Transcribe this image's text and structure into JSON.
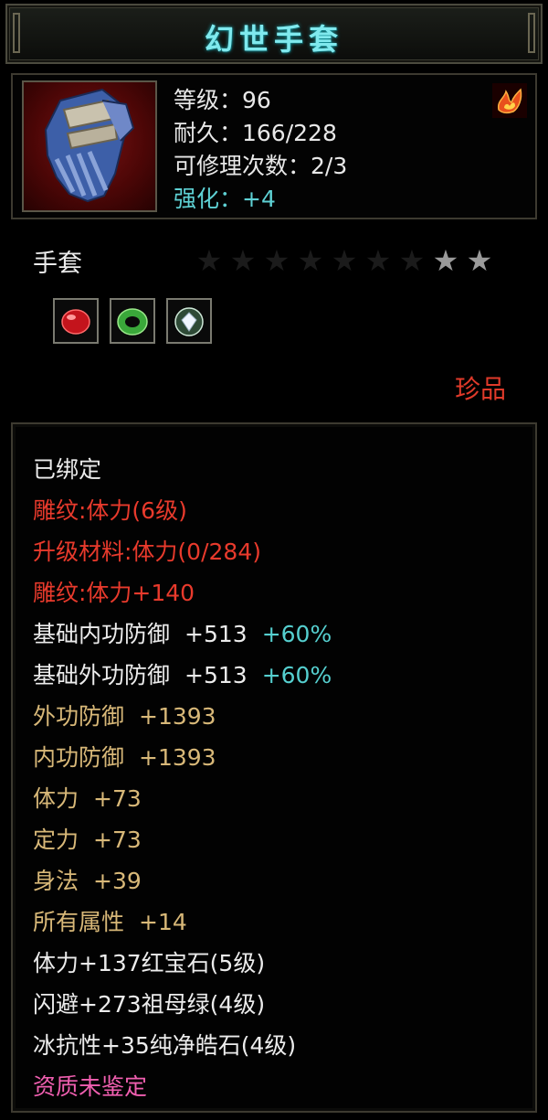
{
  "title": "幻世手套",
  "stats": {
    "level": "等级：96",
    "durability": "耐久：166/228",
    "repairs": "可修理次数：2/3",
    "enhance": "强化：+4"
  },
  "item_type": "手套",
  "stars": {
    "total": 9,
    "filled": 2
  },
  "gems": [
    "red-gem-icon",
    "green-jade-ring-icon",
    "white-diamond-icon"
  ],
  "rarity": "珍品",
  "properties": {
    "bound": "已绑定",
    "engrave_level": "雕纹:体力(6级)",
    "upgrade_material": "升级材料:体力(0/284)",
    "engrave_bonus": "雕纹:体力+140",
    "base_inner_def": {
      "label": "基础内功防御",
      "value": "+513",
      "bonus": "+60%"
    },
    "base_outer_def": {
      "label": "基础外功防御",
      "value": "+513",
      "bonus": "+60%"
    },
    "outer_def": {
      "label": "外功防御",
      "value": "+1393"
    },
    "inner_def": {
      "label": "内功防御",
      "value": "+1393"
    },
    "stamina": {
      "label": "体力",
      "value": "+73"
    },
    "focus": {
      "label": "定力",
      "value": "+73"
    },
    "agility": {
      "label": "身法",
      "value": "+39"
    },
    "all_attr": {
      "label": "所有属性",
      "value": "+14"
    },
    "gem1": "体力+137红宝石(5级)",
    "gem2": "闪避+273祖母绿(4级)",
    "gem3": "冰抗性+35纯净皓石(4级)",
    "quality": "资质未鉴定"
  },
  "colors": {
    "title": "#7fe9ee",
    "red": "#e83a2c",
    "gold": "#d8b878",
    "cyan": "#55cfcf",
    "pink": "#f05fb0"
  }
}
